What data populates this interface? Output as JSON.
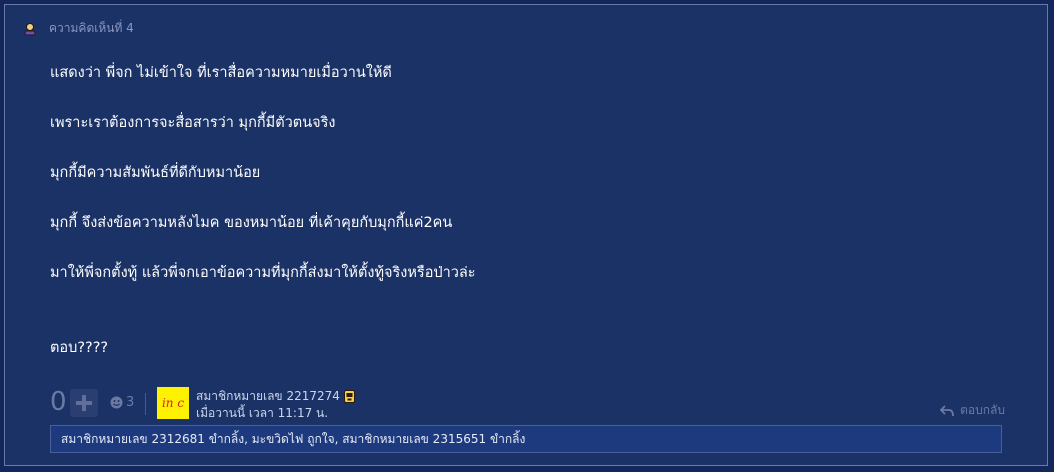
{
  "header": {
    "comment_number": "ความคิดเห็นที่ 4",
    "icon": "user-icon"
  },
  "comment": {
    "paragraphs": [
      "แสดงว่า พี่จก ไม่เข้าใจ ที่เราสื่อความหมายเมื่อวานให้ดี",
      "เพราะเราต้องการจะสื่อสารว่า มุกกี้มีตัวตนจริง",
      "มุกกี้มีความสัมพันธ์ที่ดีกับหมาน้อย",
      "มุกกี้ จึงส่งข้อความหลังไมค ของหมาน้อย ที่เค้าคุยกับมุกกี้แค่2คน",
      "มาให้พี่จกตั้งทู้  แล้วพี่จกเอาข้อความที่มุกกี้ส่งมาให้ตั้งทู้จริงหรือป่าวล่ะ",
      "ตอบ????"
    ]
  },
  "footer": {
    "vote_count": "0",
    "emotion_count": "3",
    "avatar_text": "in c",
    "author": "สมาชิกหมายเลข 2217274",
    "time": "เมื่อวานนี้ เวลา 11:17 น.",
    "reply_label": "ตอบกลับ"
  },
  "reactions": {
    "text": "สมาชิกหมายเลข 2312681 ขำกลิ้ง, มะขวิดไฟ ถูกใจ, สมาชิกหมายเลข 2315651 ขำกลิ้ง"
  },
  "colors": {
    "background": "#1b3266",
    "accent_yellow": "#fff200",
    "muted": "#6c7aa3"
  }
}
